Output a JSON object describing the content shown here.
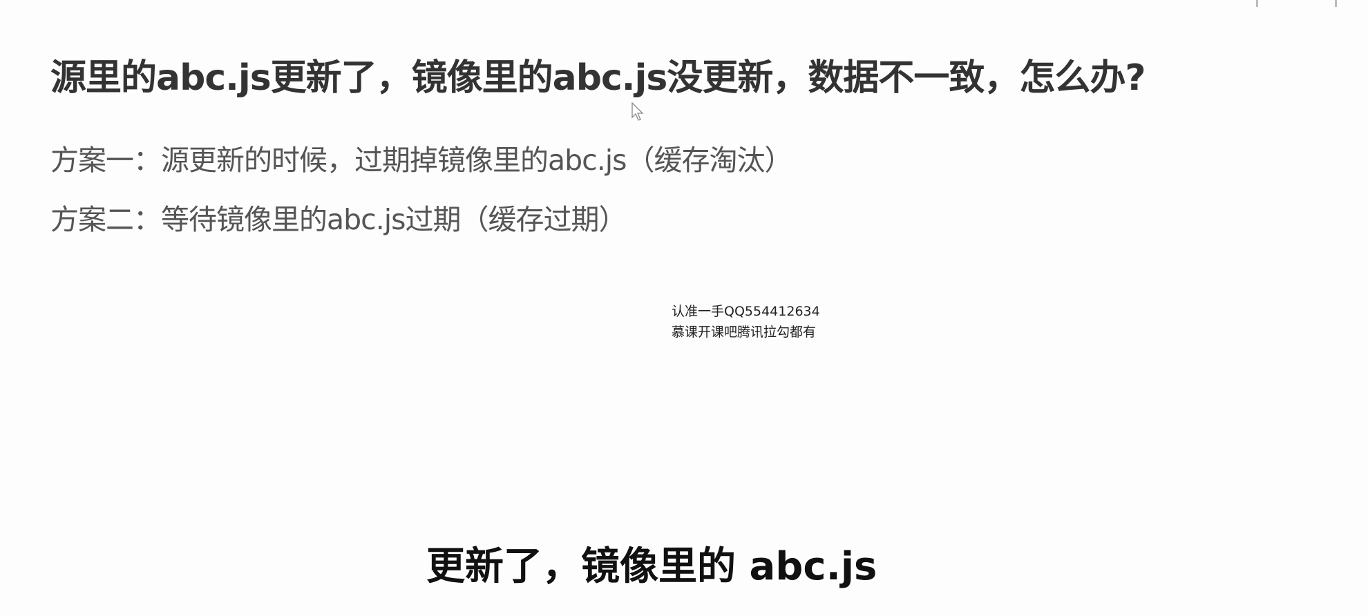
{
  "slide": {
    "title": "源里的abc.js更新了，镜像里的abc.js没更新，数据不一致，怎么办?",
    "options": [
      "方案一：源更新的时候，过期掉镜像里的abc.js（缓存淘汰）",
      "方案二：等待镜像里的abc.js过期（缓存过期）"
    ]
  },
  "watermark": {
    "line1": "认准一手QQ554412634",
    "line2": "慕课开课吧腾讯拉勾都有"
  },
  "subtitle": "更新了，镜像里的 abc.js"
}
